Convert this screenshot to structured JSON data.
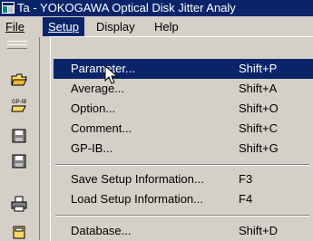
{
  "window": {
    "title": "Ta - YOKOGAWA Optical Disk Jitter Analy"
  },
  "menubar": {
    "items": [
      {
        "label": "File"
      },
      {
        "label": "Setup"
      },
      {
        "label": "Display"
      },
      {
        "label": "Help"
      }
    ],
    "active": "Setup"
  },
  "toolbar": {
    "buttons": [
      {
        "icon": "open-folder-icon"
      },
      {
        "icon": "gpib-icon"
      },
      {
        "icon": "save-disk-icon"
      },
      {
        "icon": "save-disk-icon"
      },
      {
        "icon": "printer-icon"
      },
      {
        "icon": "database-icon"
      }
    ]
  },
  "setup_menu": {
    "items": [
      {
        "label": "Parameter...",
        "shortcut": "Shift+P",
        "highlighted": true
      },
      {
        "label": "Average...",
        "shortcut": "Shift+A"
      },
      {
        "label": "Option...",
        "shortcut": "Shift+O"
      },
      {
        "label": "Comment...",
        "shortcut": "Shift+C"
      },
      {
        "label": "GP-IB...",
        "shortcut": "Shift+G"
      },
      {
        "label": "Save Setup Information...",
        "shortcut": "F3"
      },
      {
        "label": "Load Setup Information...",
        "shortcut": "F4"
      },
      {
        "label": "Database...",
        "shortcut": "Shift+D"
      }
    ]
  },
  "colors": {
    "highlight": "#0a246a",
    "face": "#d4d0c8"
  }
}
